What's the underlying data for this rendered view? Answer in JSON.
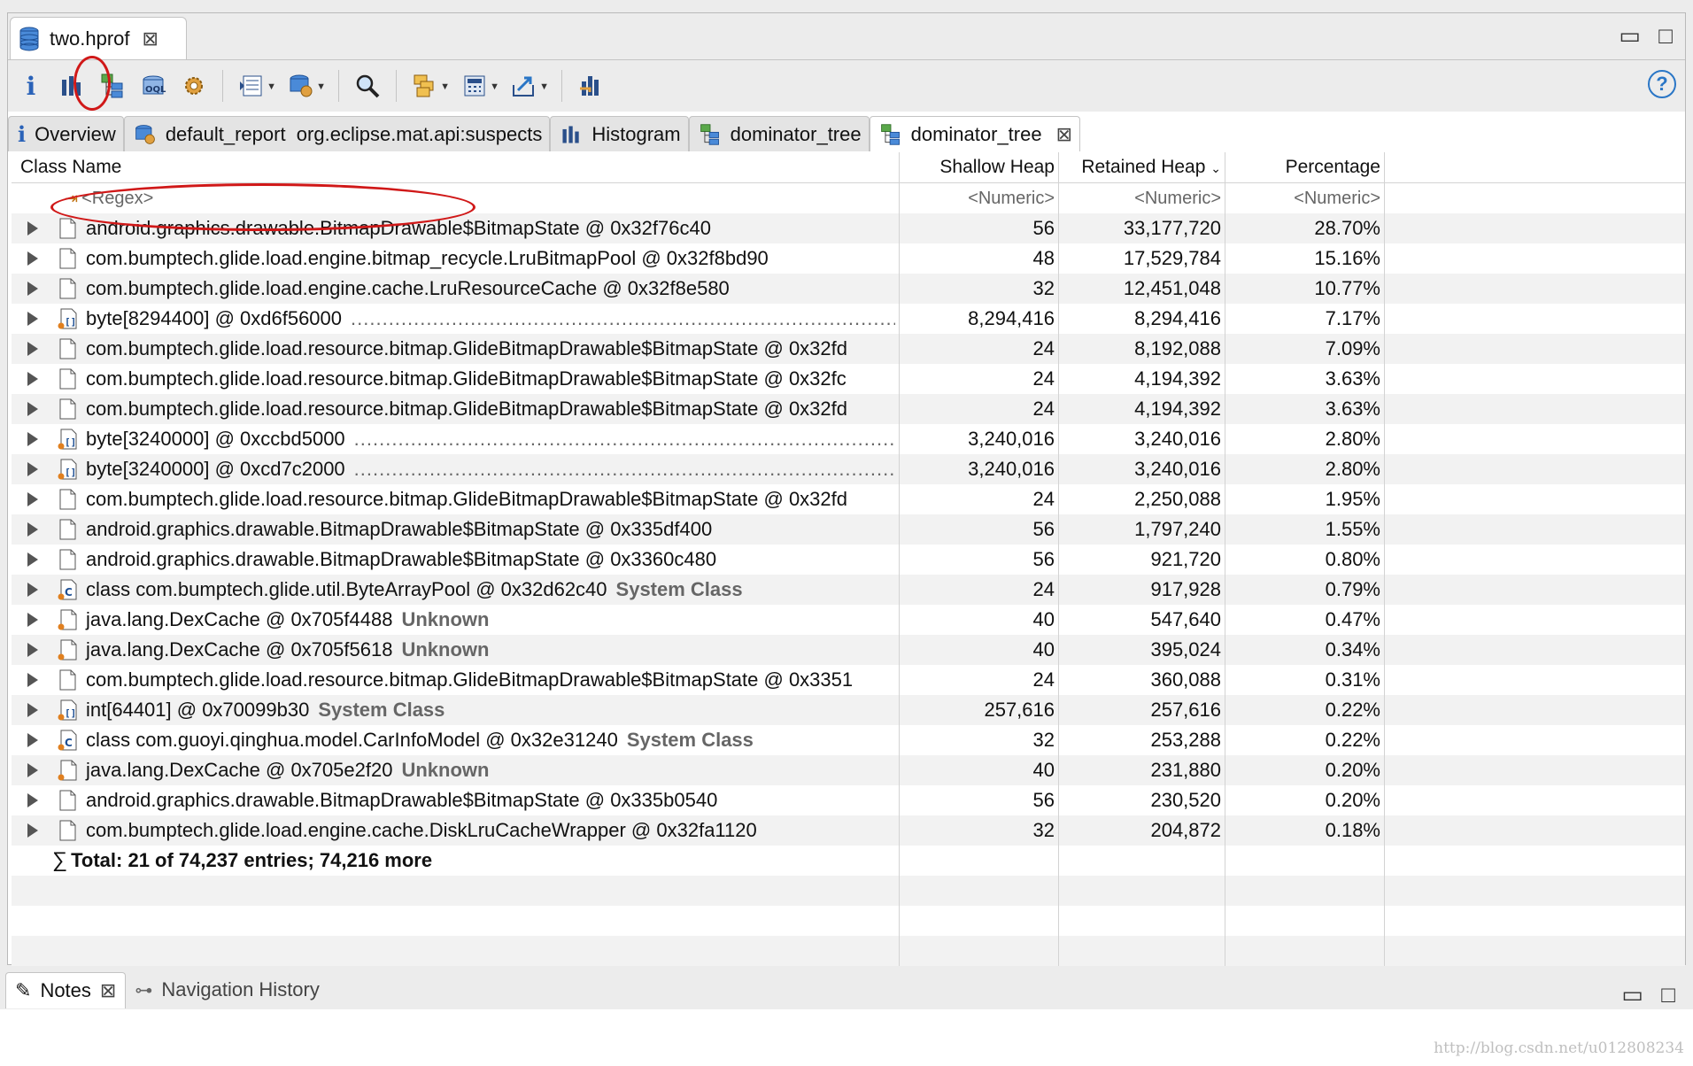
{
  "editor": {
    "tab_label": "two.hprof"
  },
  "view_tabs": [
    {
      "label": "Overview",
      "icon": "info-icon"
    },
    {
      "label": "default_report  org.eclipse.mat.api:suspects",
      "icon": "report-icon"
    },
    {
      "label": "Histogram",
      "icon": "histogram-icon"
    },
    {
      "label": "dominator_tree",
      "icon": "dominator-tree-icon"
    },
    {
      "label": "dominator_tree",
      "icon": "dominator-tree-icon",
      "active": true,
      "closable": true
    }
  ],
  "table": {
    "columns": {
      "name": "Class Name",
      "shallow": "Shallow Heap",
      "retained": "Retained Heap",
      "percentage": "Percentage"
    },
    "filter": {
      "name": "<Regex>",
      "shallow": "<Numeric>",
      "retained": "<Numeric>",
      "percentage": "<Numeric>"
    },
    "rows": [
      {
        "name": "android.graphics.drawable.BitmapDrawable$BitmapState @ 0x32f76c40",
        "icon": "object",
        "shallow": "56",
        "retained": "33,177,720",
        "percentage": "28.70%"
      },
      {
        "name": "com.bumptech.glide.load.engine.bitmap_recycle.LruBitmapPool @ 0x32f8bd90",
        "icon": "object",
        "shallow": "48",
        "retained": "17,529,784",
        "percentage": "15.16%"
      },
      {
        "name": "com.bumptech.glide.load.engine.cache.LruResourceCache @ 0x32f8e580",
        "icon": "object",
        "shallow": "32",
        "retained": "12,451,048",
        "percentage": "10.77%"
      },
      {
        "name": "byte[8294400] @ 0xd6f56000",
        "icon": "array",
        "dots": true,
        "shallow": "8,294,416",
        "retained": "8,294,416",
        "percentage": "7.17%"
      },
      {
        "name": "com.bumptech.glide.load.resource.bitmap.GlideBitmapDrawable$BitmapState @ 0x32fd",
        "icon": "object",
        "shallow": "24",
        "retained": "8,192,088",
        "percentage": "7.09%"
      },
      {
        "name": "com.bumptech.glide.load.resource.bitmap.GlideBitmapDrawable$BitmapState @ 0x32fc",
        "icon": "object",
        "shallow": "24",
        "retained": "4,194,392",
        "percentage": "3.63%"
      },
      {
        "name": "com.bumptech.glide.load.resource.bitmap.GlideBitmapDrawable$BitmapState @ 0x32fd",
        "icon": "object",
        "shallow": "24",
        "retained": "4,194,392",
        "percentage": "3.63%"
      },
      {
        "name": "byte[3240000] @ 0xccbd5000",
        "icon": "array",
        "dots": true,
        "shallow": "3,240,016",
        "retained": "3,240,016",
        "percentage": "2.80%"
      },
      {
        "name": "byte[3240000] @ 0xcd7c2000",
        "icon": "array",
        "dots": true,
        "shallow": "3,240,016",
        "retained": "3,240,016",
        "percentage": "2.80%"
      },
      {
        "name": "com.bumptech.glide.load.resource.bitmap.GlideBitmapDrawable$BitmapState @ 0x32fd",
        "icon": "object",
        "shallow": "24",
        "retained": "2,250,088",
        "percentage": "1.95%"
      },
      {
        "name": "android.graphics.drawable.BitmapDrawable$BitmapState @ 0x335df400",
        "icon": "object",
        "shallow": "56",
        "retained": "1,797,240",
        "percentage": "1.55%"
      },
      {
        "name": "android.graphics.drawable.BitmapDrawable$BitmapState @ 0x3360c480",
        "icon": "object",
        "shallow": "56",
        "retained": "921,720",
        "percentage": "0.80%"
      },
      {
        "name": "class com.bumptech.glide.util.ByteArrayPool @ 0x32d62c40",
        "icon": "class",
        "suffix": "System Class",
        "shallow": "24",
        "retained": "917,928",
        "percentage": "0.79%"
      },
      {
        "name": "java.lang.DexCache @ 0x705f4488",
        "icon": "gc-object",
        "suffix": "Unknown",
        "shallow": "40",
        "retained": "547,640",
        "percentage": "0.47%"
      },
      {
        "name": "java.lang.DexCache @ 0x705f5618",
        "icon": "gc-object",
        "suffix": "Unknown",
        "shallow": "40",
        "retained": "395,024",
        "percentage": "0.34%"
      },
      {
        "name": "com.bumptech.glide.load.resource.bitmap.GlideBitmapDrawable$BitmapState @ 0x3351",
        "icon": "object",
        "shallow": "24",
        "retained": "360,088",
        "percentage": "0.31%"
      },
      {
        "name": "int[64401] @ 0x70099b30",
        "icon": "array",
        "suffix": "System Class",
        "shallow": "257,616",
        "retained": "257,616",
        "percentage": "0.22%"
      },
      {
        "name": "class com.guoyi.qinghua.model.CarInfoModel @ 0x32e31240",
        "icon": "class",
        "suffix": "System Class",
        "shallow": "32",
        "retained": "253,288",
        "percentage": "0.22%"
      },
      {
        "name": "java.lang.DexCache @ 0x705e2f20",
        "icon": "gc-object",
        "suffix": "Unknown",
        "shallow": "40",
        "retained": "231,880",
        "percentage": "0.20%"
      },
      {
        "name": "android.graphics.drawable.BitmapDrawable$BitmapState @ 0x335b0540",
        "icon": "object",
        "shallow": "56",
        "retained": "230,520",
        "percentage": "0.20%"
      },
      {
        "name": "com.bumptech.glide.load.engine.cache.DiskLruCacheWrapper @ 0x32fa1120",
        "icon": "object",
        "shallow": "32",
        "retained": "204,872",
        "percentage": "0.18%"
      }
    ],
    "total": "Total: 21 of 74,237 entries; 74,216 more"
  },
  "bottom_panel": {
    "tabs": [
      {
        "label": "Notes",
        "active": true
      },
      {
        "label": "Navigation History",
        "active": false
      }
    ]
  },
  "watermark": "http://blog.csdn.net/u012808234",
  "colors": {
    "annotation": "#d01818",
    "accent": "#2a76c6"
  }
}
